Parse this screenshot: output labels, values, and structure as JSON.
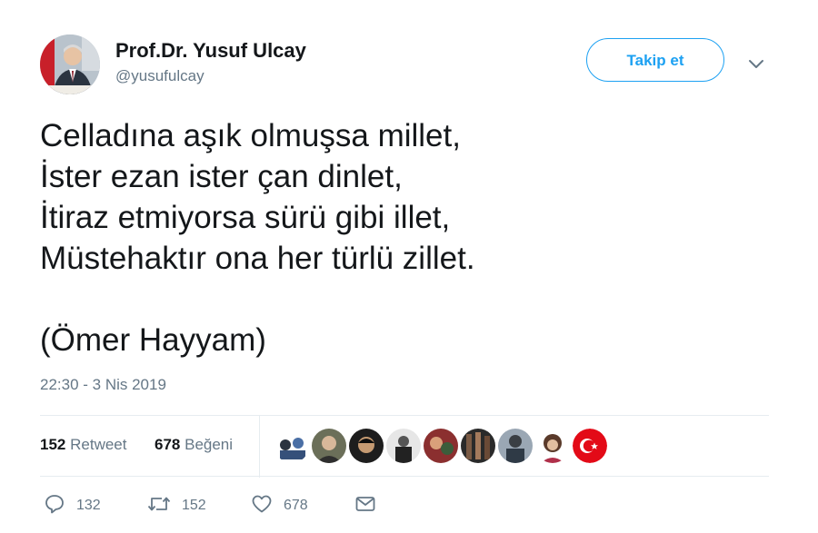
{
  "author": {
    "display_name": "Prof.Dr. Yusuf Ulcay",
    "username": "@yusufulcay"
  },
  "follow_button": {
    "label": "Takip et"
  },
  "tweet": {
    "lines": [
      "Celladına aşık olmuşsa millet,",
      "İster ezan ister çan dinlet,",
      "İtiraz etmiyorsa sürü gibi illet,",
      "Müstehaktır ona her türlü zillet."
    ],
    "attribution": "(Ömer Hayyam)",
    "timestamp": "22:30 - 3 Nis 2019"
  },
  "stats": {
    "retweet_count": "152",
    "retweet_label": "Retweet",
    "like_count": "678",
    "like_label": "Beğeni"
  },
  "actions": {
    "reply_count": "132",
    "retweet_count": "152",
    "like_count": "678"
  },
  "colors": {
    "accent": "#1da1f2",
    "text": "#14171a",
    "secondary": "#657786",
    "border": "#e6ecf0"
  }
}
